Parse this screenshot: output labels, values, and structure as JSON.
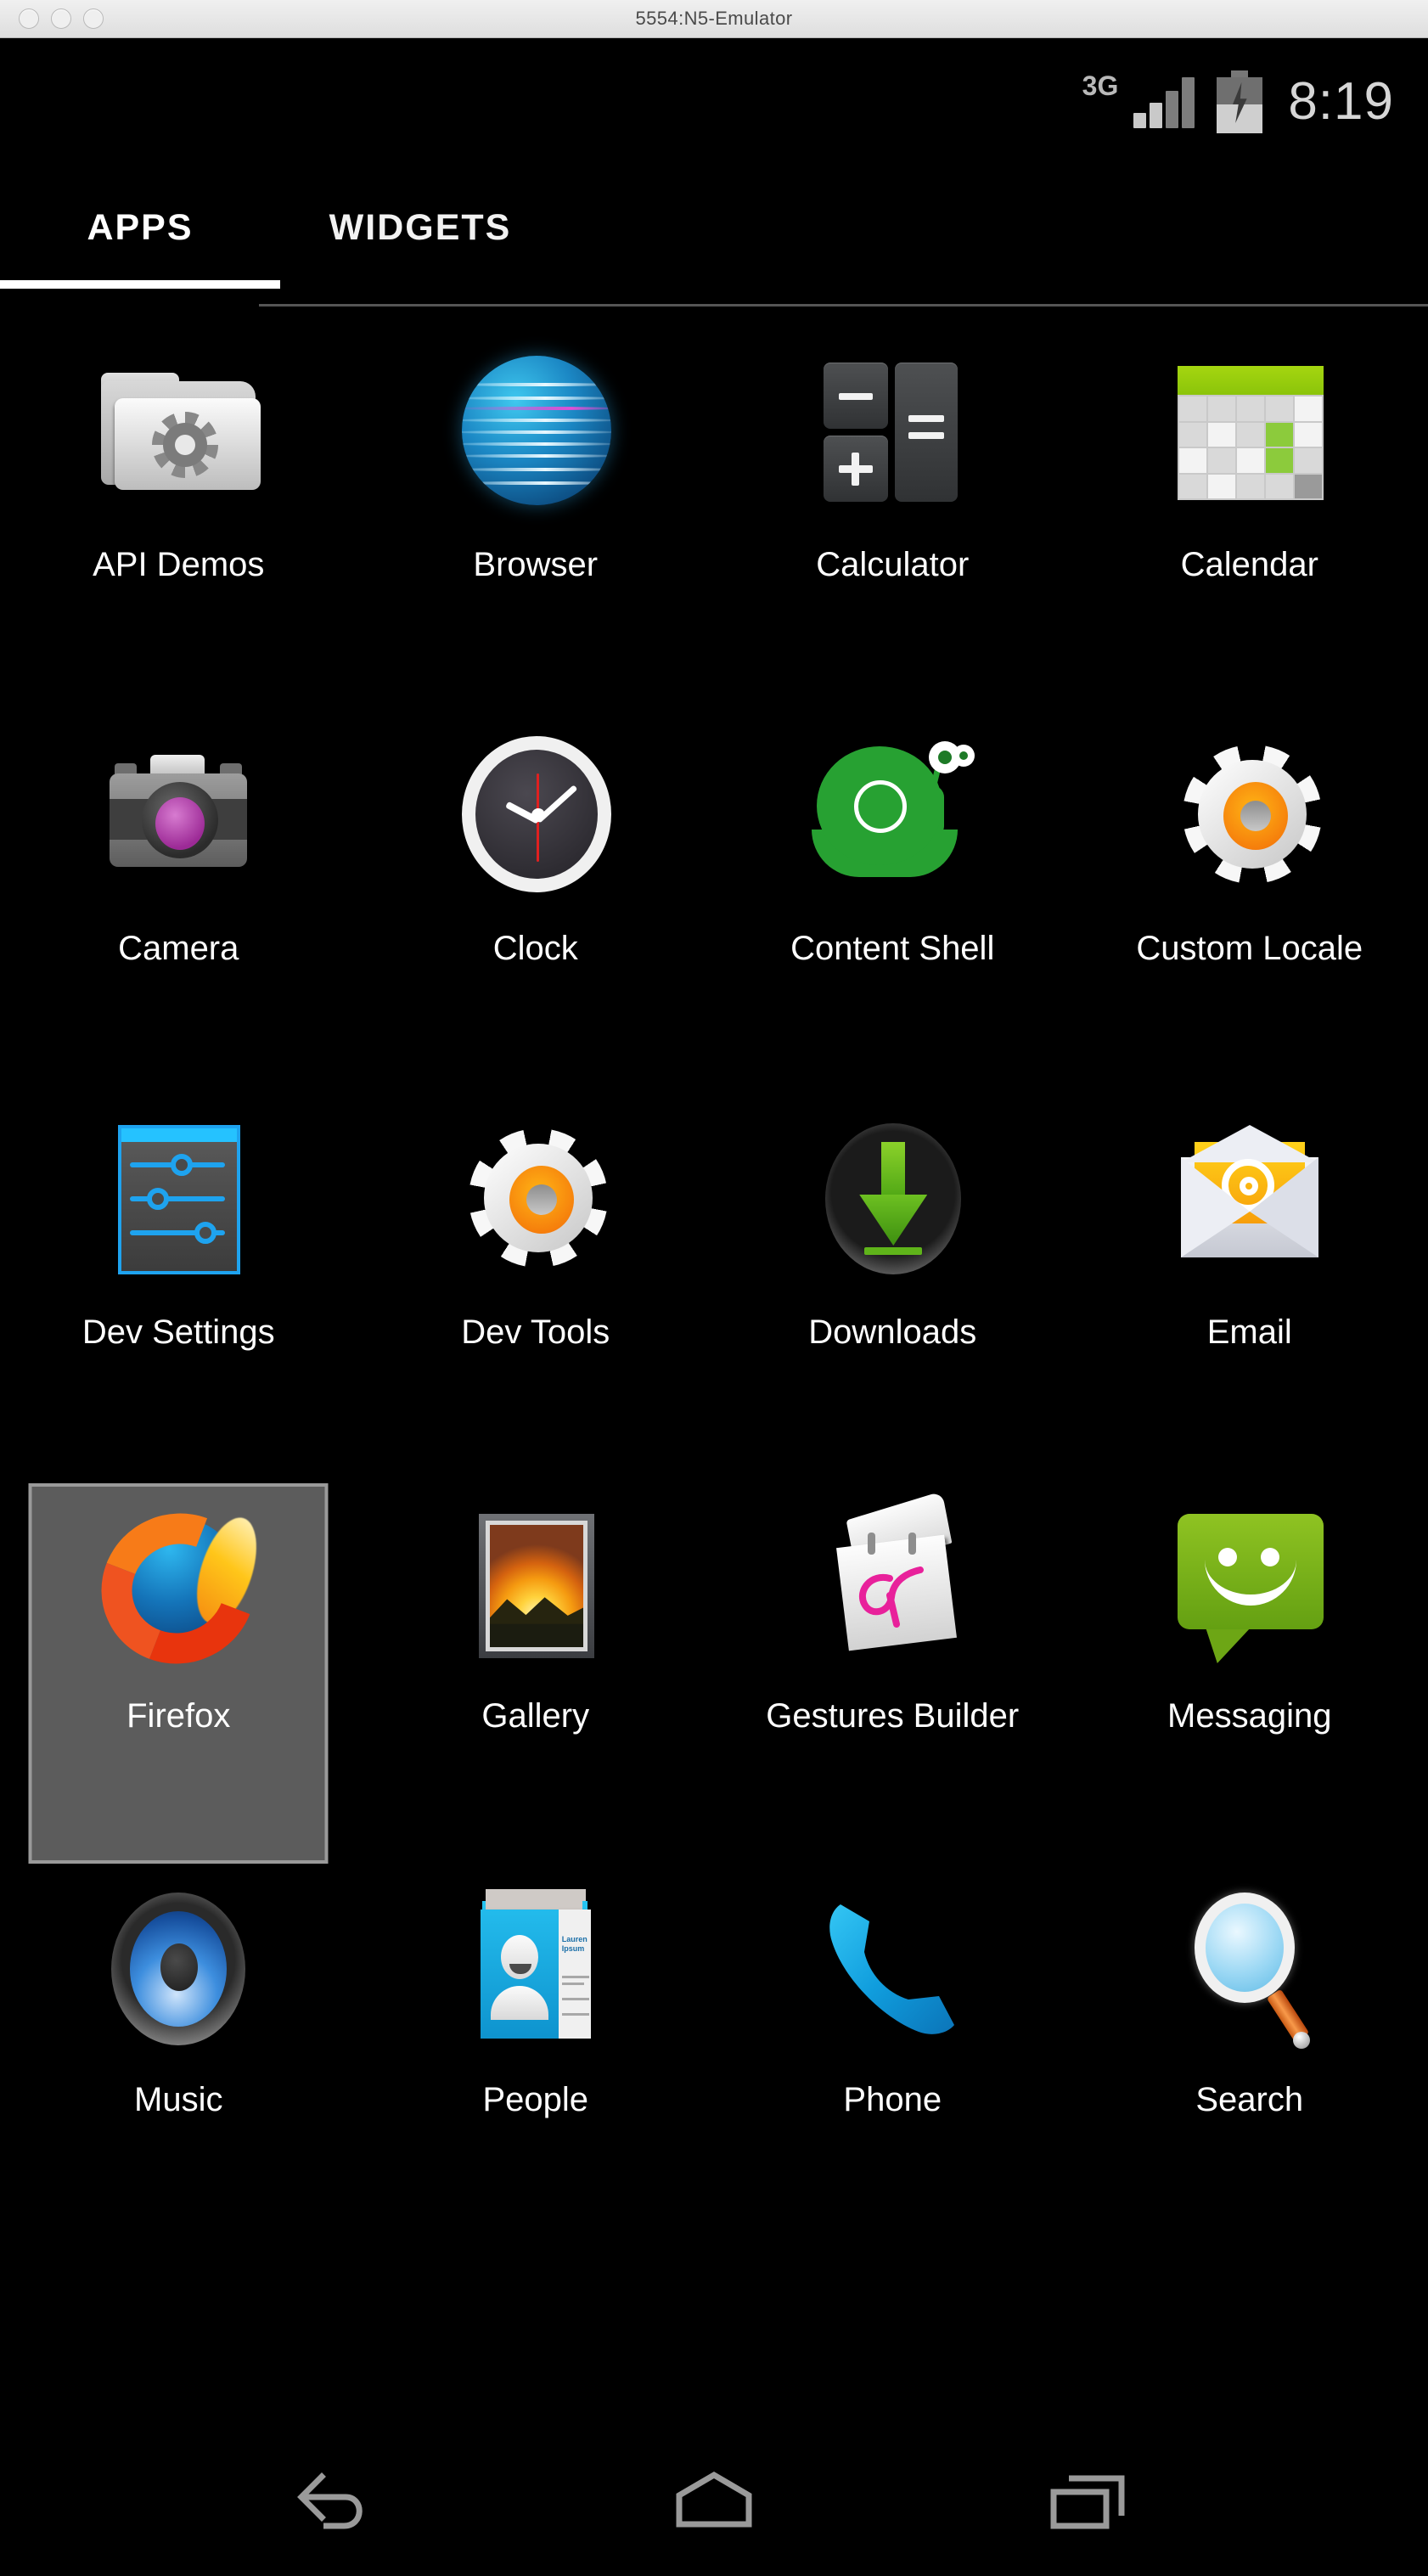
{
  "window": {
    "title": "5554:N5-Emulator",
    "controls": [
      "close",
      "minimize",
      "zoom"
    ]
  },
  "status_bar": {
    "network_type": "3G",
    "signal_bars_total": 4,
    "signal_bars_filled": 2,
    "battery_state": "charging",
    "time": "8:19"
  },
  "tabs": [
    {
      "label": "APPS",
      "selected": true
    },
    {
      "label": "WIDGETS",
      "selected": false
    }
  ],
  "apps": [
    {
      "label": "API Demos",
      "icon": "folder-gear-icon",
      "selected": false
    },
    {
      "label": "Browser",
      "icon": "globe-icon",
      "selected": false
    },
    {
      "label": "Calculator",
      "icon": "calculator-keys-icon",
      "selected": false
    },
    {
      "label": "Calendar",
      "icon": "calendar-grid-icon",
      "selected": false
    },
    {
      "label": "Camera",
      "icon": "camera-icon",
      "selected": false
    },
    {
      "label": "Clock",
      "icon": "analog-clock-icon",
      "selected": false
    },
    {
      "label": "Content Shell",
      "icon": "snail-icon",
      "selected": false
    },
    {
      "label": "Custom Locale",
      "icon": "gear-orange-icon",
      "selected": false
    },
    {
      "label": "Dev Settings",
      "icon": "sliders-icon",
      "selected": false
    },
    {
      "label": "Dev Tools",
      "icon": "gear-orange-icon",
      "selected": false
    },
    {
      "label": "Downloads",
      "icon": "download-arrow-icon",
      "selected": false
    },
    {
      "label": "Email",
      "icon": "envelope-at-icon",
      "selected": false
    },
    {
      "label": "Firefox",
      "icon": "firefox-icon",
      "selected": true
    },
    {
      "label": "Gallery",
      "icon": "picture-frame-icon",
      "selected": false
    },
    {
      "label": "Gestures Builder",
      "icon": "notepad-gesture-icon",
      "selected": false
    },
    {
      "label": "Messaging",
      "icon": "speech-bubble-icon",
      "selected": false
    },
    {
      "label": "Music",
      "icon": "speaker-icon",
      "selected": false
    },
    {
      "label": "People",
      "icon": "contact-card-icon",
      "selected": false
    },
    {
      "label": "Phone",
      "icon": "handset-icon",
      "selected": false
    },
    {
      "label": "Search",
      "icon": "magnifier-icon",
      "selected": false
    }
  ],
  "people_card": {
    "name_line1": "Lauren",
    "name_line2": "Ipsum"
  },
  "nav_bar": [
    {
      "label": "Back",
      "icon": "back-arrow-icon"
    },
    {
      "label": "Home",
      "icon": "home-icon"
    },
    {
      "label": "Recents",
      "icon": "recents-icon"
    }
  ],
  "colors": {
    "screen_background": "#000000",
    "selection_fill": "#5c5c5c",
    "selection_border": "#9a9a9a",
    "tab_indicator": "#ffffff",
    "label_text": "#ffffff",
    "status_text": "#d6d6d6",
    "nav_icon": "#9a9a9a"
  }
}
